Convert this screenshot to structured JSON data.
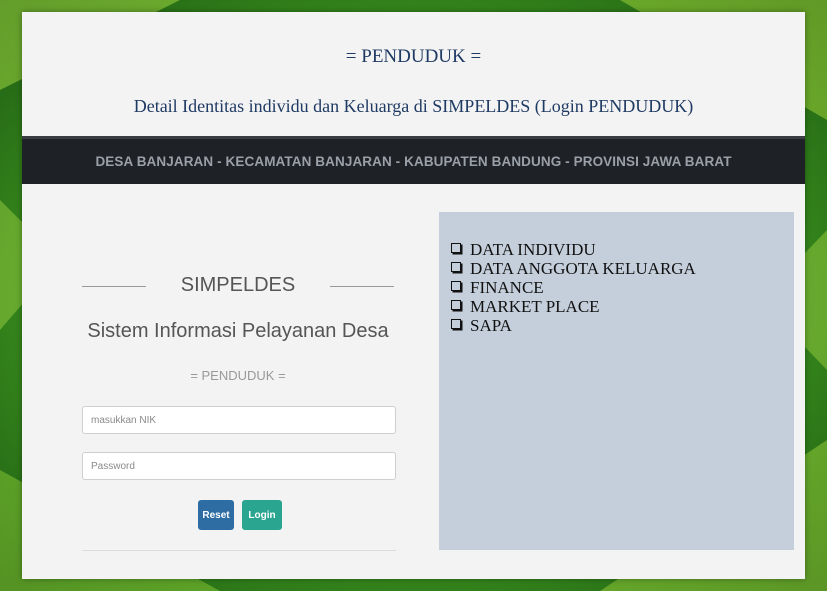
{
  "slide": {
    "title": "= PENDUDUK =",
    "subtitle": "Detail Identitas individu dan Keluarga di SIMPELDES (Login PENDUDUK)",
    "banner": "DESA BANJARAN - KECAMATAN BANJARAN - KABUPATEN BANDUNG - PROVINSI JAWA BARAT"
  },
  "login": {
    "brand": "SIMPELDES",
    "system_name": "Sistem Informasi Pelayanan Desa",
    "role": "= PENDUDUK =",
    "nik_placeholder": "masukkan NIK",
    "password_placeholder": "Password",
    "reset_label": "Reset",
    "login_label": "Login"
  },
  "menu": {
    "items": [
      {
        "label": "DATA INDIVIDU"
      },
      {
        "label": "DATA ANGGOTA KELUARGA"
      },
      {
        "label": "FINANCE"
      },
      {
        "label": "MARKET PLACE"
      },
      {
        "label": "SAPA"
      }
    ],
    "bullet_icon": "checkbox-bullet-icon"
  },
  "colors": {
    "background": "#2e7d1f",
    "banner": "#1e2126",
    "menu_panel": "#c5cfdc",
    "reset_button": "#2e6da4",
    "login_button": "#2aa58f",
    "title_text": "#1f3a63"
  }
}
